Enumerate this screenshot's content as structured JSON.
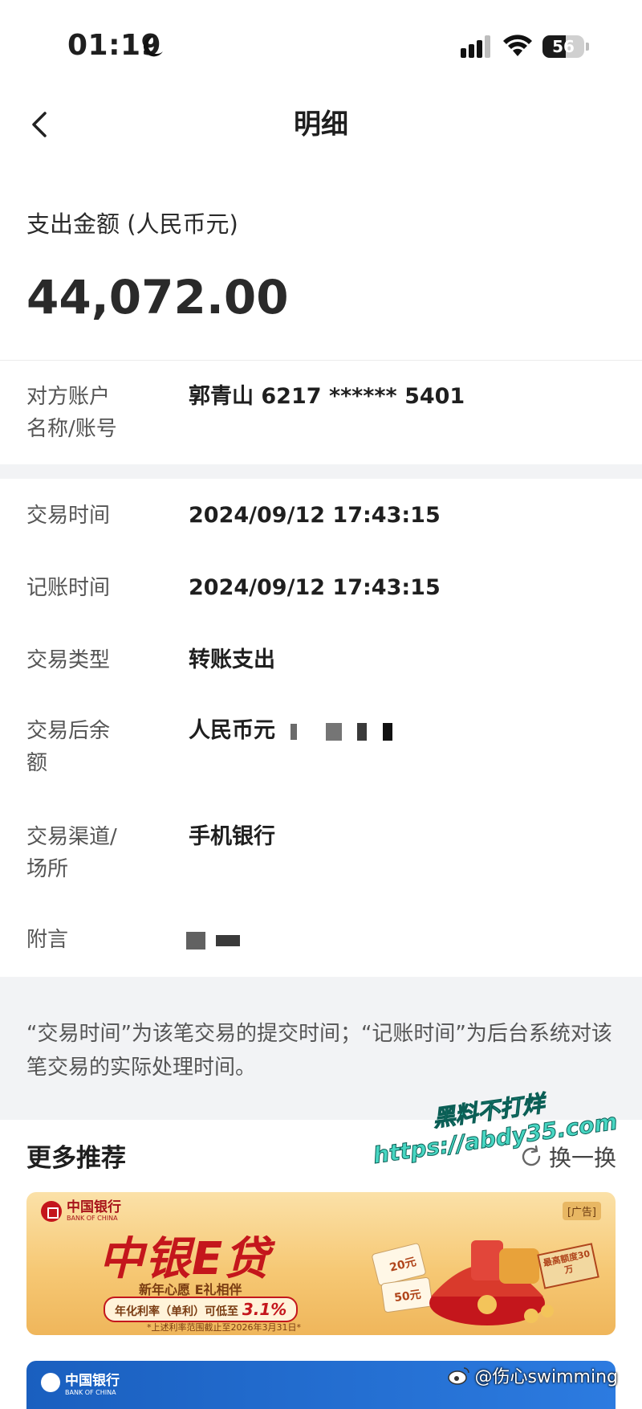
{
  "status_bar": {
    "time": "01:19",
    "battery": "56",
    "battery_level": 0.56
  },
  "nav": {
    "title": "明细"
  },
  "amount": {
    "label": "支出金额 (人民币元)",
    "value": "44,072.00"
  },
  "counterparty": {
    "label_line1": "对方账户",
    "label_line2": "名称/账号",
    "value": "郭青山 6217 ****** 5401"
  },
  "details": [
    {
      "label_line1": "交易时间",
      "label_line2": "",
      "value": "2024/09/12 17:43:15"
    },
    {
      "label_line1": "记账时间",
      "label_line2": "",
      "value": "2024/09/12 17:43:15"
    },
    {
      "label_line1": "交易类型",
      "label_line2": "",
      "value": "转账支出"
    },
    {
      "label_line1": "交易后余",
      "label_line2": "额",
      "value": "人民币元"
    },
    {
      "label_line1": "交易渠道/",
      "label_line2": "场所",
      "value": "手机银行"
    },
    {
      "label_line1": "附言",
      "label_line2": "",
      "value": ""
    }
  ],
  "note": {
    "text": "“交易时间”为该笔交易的提交时间；“记账时间”为后台系统对该笔交易的实际处理时间。"
  },
  "recommend": {
    "title": "更多推荐",
    "refresh_label": "换一换"
  },
  "watermark": {
    "line1": "黑料不打烊",
    "line2": "https://abdy35.com"
  },
  "ad1": {
    "bank_name": "中国银行",
    "bank_name_en": "BANK OF CHINA",
    "tag": "[广告]",
    "title": "中银E贷",
    "subtitle": "新年心愿 E礼相伴",
    "rate_text": "年化利率（单利）可低至",
    "rate_value": "3.1%",
    "footnote": "*上述利率范围截止至2026年3月31日*",
    "badge": "最高额度30万",
    "coupon1": "20元",
    "coupon2": "50元"
  },
  "ad2": {
    "bank_name": "中国银行",
    "bank_name_en": "BANK OF CHINA"
  },
  "weibo": {
    "handle": "@伤心swimming"
  },
  "colors": {
    "accent_red": "#c4161c",
    "note_bg": "#f2f3f5",
    "label_gray": "#555555"
  }
}
